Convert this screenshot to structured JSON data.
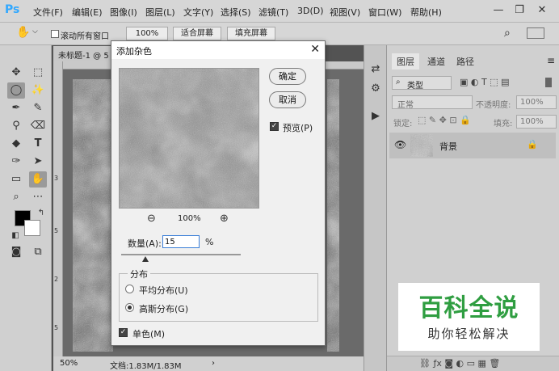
{
  "app": {
    "logo": "Ps",
    "menu": [
      "文件(F)",
      "编辑(E)",
      "图像(I)",
      "图层(L)",
      "文字(Y)",
      "选择(S)",
      "滤镜(T)",
      "3D(D)",
      "视图(V)",
      "窗口(W)",
      "帮助(H)"
    ],
    "window_controls": {
      "minimize": "—",
      "restore": "❐",
      "close": "✕"
    }
  },
  "options_bar": {
    "scroll_all_label": "滚动所有窗口",
    "zoom_100": "100%",
    "fit_screen": "适合屏幕",
    "fill_screen": "填充屏幕"
  },
  "document": {
    "tab_title": "未标题-1 @ 5",
    "ruler_marks": [
      "3",
      "5",
      "2",
      "5"
    ],
    "status_zoom": "50%",
    "status_doc": "文档:1.83M/1.83M"
  },
  "dialog": {
    "title": "添加杂色",
    "ok": "确定",
    "cancel": "取消",
    "preview_label": "预览(P)",
    "preview_checked": true,
    "zoom_level": "100%",
    "amount_label": "数量(A):",
    "amount_value": "15",
    "amount_unit": "%",
    "amount_percent": 15,
    "distribution_label": "分布",
    "uniform_label": "平均分布(U)",
    "gaussian_label": "高斯分布(G)",
    "selected_distribution": "gaussian",
    "mono_label": "单色(M)",
    "mono_checked": true
  },
  "layers_panel": {
    "tabs": [
      "图层",
      "通道",
      "路径"
    ],
    "kind_filter": "类型",
    "blend_mode": "正常",
    "opacity_label": "不透明度:",
    "opacity_value": "100%",
    "lock_label": "锁定:",
    "fill_label": "填充:",
    "fill_value": "100%",
    "layer_name": "背景"
  },
  "watermark": {
    "title": "百科全说",
    "subtitle": "助你轻松解决",
    "color": "#2f9e41"
  },
  "colors": {
    "foreground": "#000000",
    "background": "#ffffff",
    "accent": "#31a8ff"
  }
}
